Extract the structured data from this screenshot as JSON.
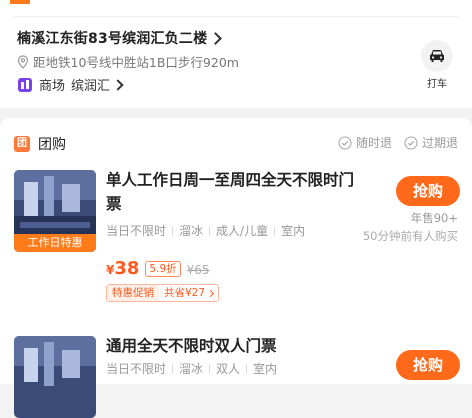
{
  "location": {
    "address": "楠溪江东街83号缤润汇负二楼",
    "subway": "距地铁10号线中胜站1B口步行920m",
    "mall_prefix": "商场",
    "mall_name": "缤润汇",
    "taxi_label": "打车"
  },
  "group_buy": {
    "badge": "团",
    "title": "团购",
    "guarantees": [
      "随时退",
      "过期退"
    ]
  },
  "deals": [
    {
      "name": "单人工作日周一至周四全天不限时门票",
      "thumb_tag": "工作日特惠",
      "tags": [
        "当日不限时",
        "溜冰",
        "成人/儿童",
        "室内"
      ],
      "buy_label": "抢购",
      "sales": "年售90+",
      "recent": "50分钟前有人购买",
      "price_symbol": "¥",
      "price": "38",
      "discount": "5.9折",
      "original_price": "¥65",
      "promo_label": "特惠促销",
      "promo_save": "共省¥27"
    },
    {
      "name": "通用全天不限时双人门票",
      "tags": [
        "当日不限时",
        "溜冰",
        "双人",
        "室内"
      ],
      "buy_label": "抢购"
    }
  ],
  "colors": {
    "accent": "#ff6a1a",
    "price": "#ff5a1f",
    "background": "#f3f3f3"
  }
}
